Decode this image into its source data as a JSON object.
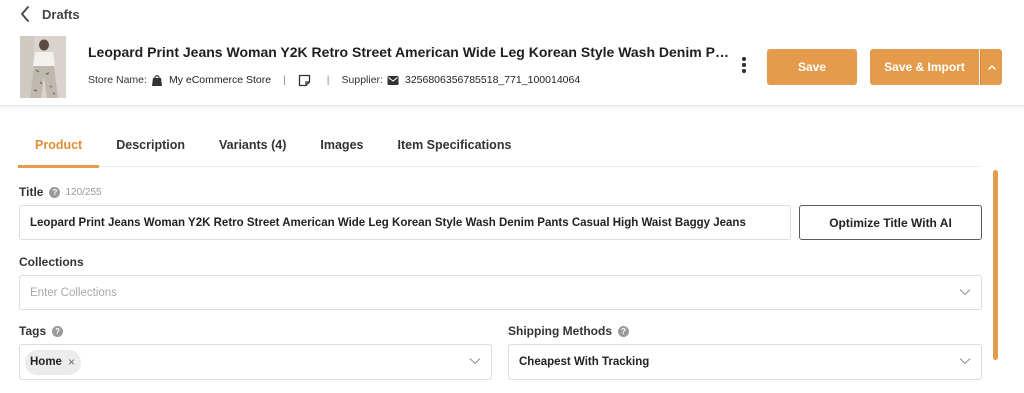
{
  "header": {
    "back_label": "Drafts",
    "product_title": "Leopard Print Jeans Woman Y2K Retro Street American Wide Leg Korean Style Wash Denim Pants...",
    "store_label": "Store Name:",
    "store_value": "My eCommerce Store",
    "supplier_label": "Supplier:",
    "supplier_value": "3256806356785518_771_100014064",
    "save_label": "Save",
    "save_import_label": "Save & Import"
  },
  "tabs": [
    {
      "label": "Product",
      "active": true
    },
    {
      "label": "Description",
      "active": false
    },
    {
      "label": "Variants (4)",
      "active": false
    },
    {
      "label": "Images",
      "active": false
    },
    {
      "label": "Item Specifications",
      "active": false
    }
  ],
  "form": {
    "title_label": "Title",
    "title_counter": "120/255",
    "title_value": "Leopard Print Jeans Woman Y2K Retro Street American Wide Leg Korean Style Wash Denim Pants Casual High Waist Baggy Jeans",
    "optimize_label": "Optimize Title With AI",
    "collections_label": "Collections",
    "collections_placeholder": "Enter Collections",
    "tags_label": "Tags",
    "tags": [
      "Home"
    ],
    "shipping_label": "Shipping Methods",
    "shipping_value": "Cheapest With Tracking"
  },
  "colors": {
    "accent": "#e49c4c",
    "accent_text": "#e08e33"
  },
  "icons": {
    "back": "chevron-left-icon",
    "store": "shopping-bag-icon",
    "note": "note-icon",
    "supplier": "mail-icon",
    "more": "more-vertical-icon",
    "dropdown": "chevron-down-icon",
    "help": "help-icon"
  }
}
